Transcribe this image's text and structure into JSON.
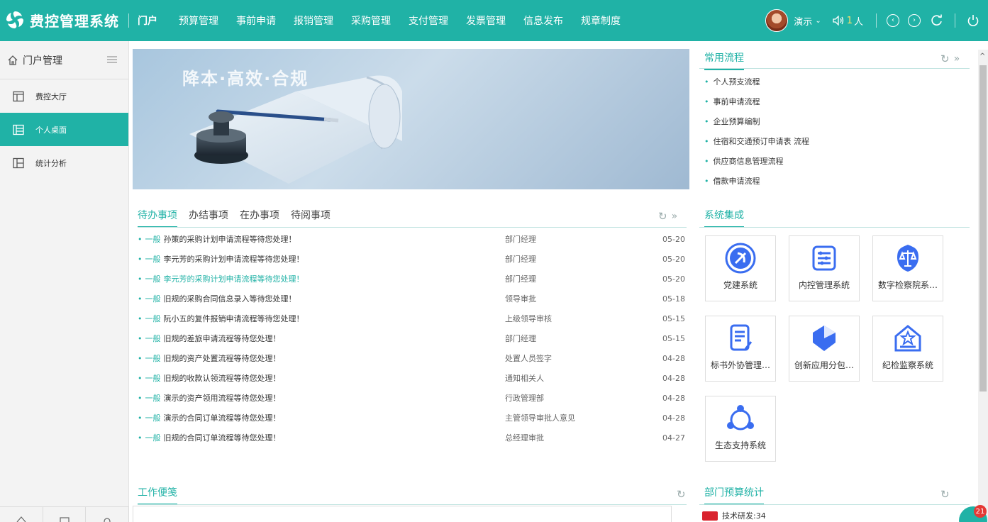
{
  "app": {
    "title": "费控管理系统"
  },
  "nav": {
    "items": [
      "门户",
      "预算管理",
      "事前申请",
      "报销管理",
      "采购管理",
      "支付管理",
      "发票管理",
      "信息发布",
      "规章制度"
    ],
    "active": "门户"
  },
  "user": {
    "name": "演示",
    "online_count": "1",
    "online_unit": "人"
  },
  "sidebar": {
    "title": "门户管理",
    "items": [
      {
        "label": "费控大厅"
      },
      {
        "label": "个人桌面"
      },
      {
        "label": "统计分析"
      }
    ]
  },
  "banner": {
    "slogan": "降本·高效·合规"
  },
  "todo": {
    "tabs": [
      "待办事项",
      "办结事项",
      "在办事项",
      "待阅事项"
    ],
    "rows": [
      {
        "level": "一般",
        "title": "孙策的采购计划申请流程等待您处理！",
        "dept": "部门经理",
        "date": "05-20"
      },
      {
        "level": "一般",
        "title": "李元芳的采购计划申请流程等待您处理！",
        "dept": "部门经理",
        "date": "05-20"
      },
      {
        "level": "一般",
        "title": "李元芳的采购计划申请流程等待您处理！",
        "dept": "部门经理",
        "date": "05-20"
      },
      {
        "level": "一般",
        "title": "旧规的采购合同信息录入等待您处理！",
        "dept": "领导审批",
        "date": "05-18"
      },
      {
        "level": "一般",
        "title": "阮小五的复件报销申请流程等待您处理！",
        "dept": "上级领导审核",
        "date": "05-15"
      },
      {
        "level": "一般",
        "title": "旧规的差旅申请流程等待您处理！",
        "dept": "部门经理",
        "date": "05-15"
      },
      {
        "level": "一般",
        "title": "旧规的资产处置流程等待您处理！",
        "dept": "处置人员签字",
        "date": "04-28"
      },
      {
        "level": "一般",
        "title": "旧规的收款认领流程等待您处理！",
        "dept": "通知相关人",
        "date": "04-28"
      },
      {
        "level": "一般",
        "title": "演示的资产领用流程等待您处理！",
        "dept": "行政管理部",
        "date": "04-28"
      },
      {
        "level": "一般",
        "title": "演示的合同订单流程等待您处理！",
        "dept": "主管领导审批人意见",
        "date": "04-28"
      },
      {
        "level": "一般",
        "title": "旧规的合同订单流程等待您处理！",
        "dept": "总经理审批",
        "date": "04-27"
      }
    ]
  },
  "common_flows": {
    "title": "常用流程",
    "items": [
      "个人预支流程",
      "事前申请流程",
      "企业预算编制",
      "住宿和交通预订申请表 流程",
      "供应商信息管理流程",
      "借款申请流程"
    ]
  },
  "systems": {
    "title": "系统集成",
    "items": [
      {
        "label": "党建系统",
        "icon": "party-emblem-icon"
      },
      {
        "label": "内控管理系统",
        "icon": "list-icon"
      },
      {
        "label": "数字检察院系…",
        "icon": "scales-icon"
      },
      {
        "label": "标书外协管理…",
        "icon": "document-pen-icon"
      },
      {
        "label": "创新应用分包…",
        "icon": "pie-chart-icon"
      },
      {
        "label": "纪检监察系统",
        "icon": "house-star-icon"
      },
      {
        "label": "生态支持系统",
        "icon": "people-network-icon"
      }
    ]
  },
  "memo": {
    "title": "工作便笺"
  },
  "budget": {
    "title": "部门预算统计",
    "legend": [
      {
        "label": "技术研发:34",
        "color": "#d9232e"
      }
    ]
  },
  "notifications": {
    "count": "21"
  },
  "colors": {
    "primary": "#20b2a6",
    "danger": "#d9232e"
  }
}
